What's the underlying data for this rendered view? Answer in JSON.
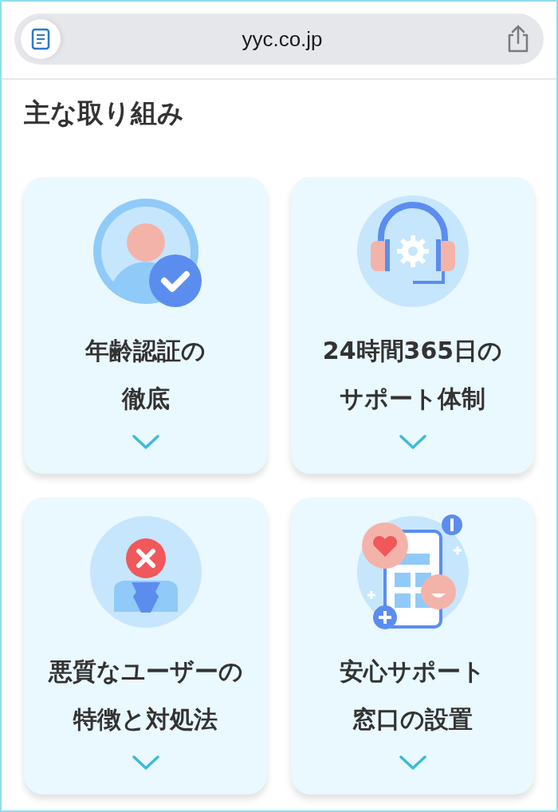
{
  "browser": {
    "url": "yyc.co.jp"
  },
  "section_title": "主な取り組み",
  "cards": [
    {
      "kind": "verified-user",
      "lines": [
        "年齢認証の",
        "徹底"
      ]
    },
    {
      "kind": "headset",
      "lines": [
        "24時間365日の",
        "サポート体制"
      ]
    },
    {
      "kind": "blocked-user",
      "lines": [
        "悪質なユーザーの",
        "特徴と対処法"
      ]
    },
    {
      "kind": "phone-support",
      "lines": [
        "安心サポート",
        "窓口の設置"
      ]
    }
  ]
}
